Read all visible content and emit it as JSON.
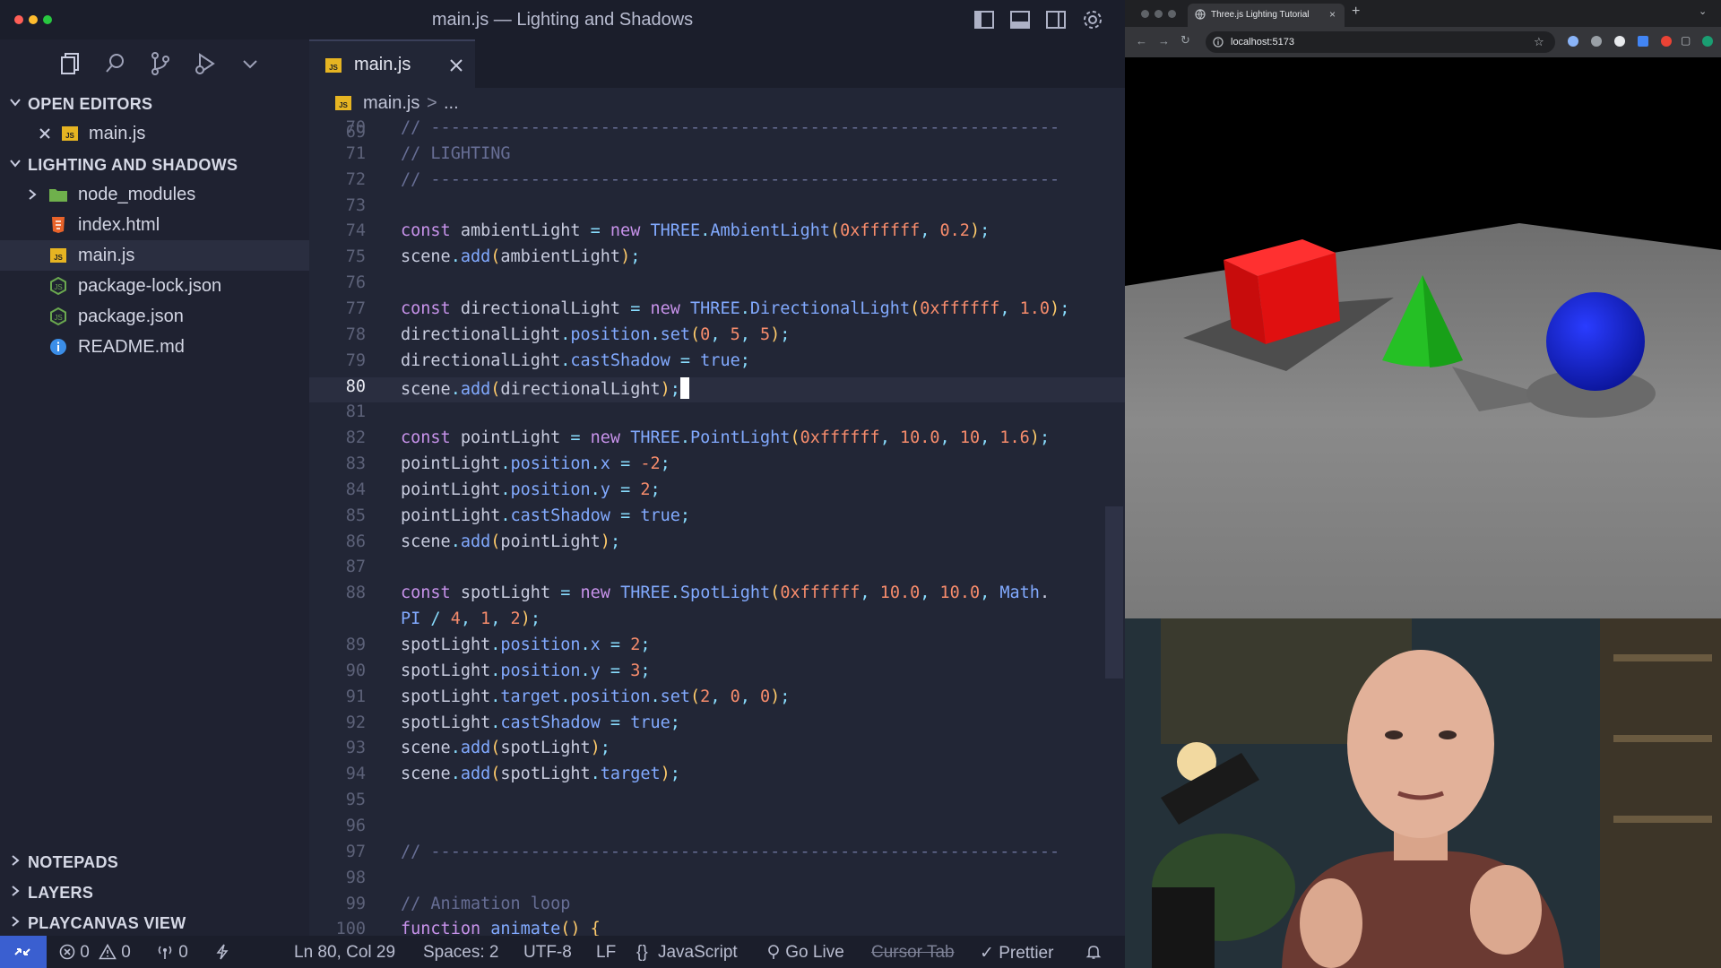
{
  "window": {
    "title": "main.js — Lighting and Shadows"
  },
  "tabs": [
    {
      "label": "main.js",
      "icon": "js-file-icon",
      "active": true
    }
  ],
  "breadcrumb": {
    "file": "main.js",
    "separator": ">",
    "rest": "..."
  },
  "sidebar": {
    "open_editors": {
      "title": "OPEN EDITORS",
      "items": [
        {
          "label": "main.js",
          "icon": "js-file-icon"
        }
      ]
    },
    "project": {
      "title": "LIGHTING AND SHADOWS",
      "items": [
        {
          "label": "node_modules",
          "icon": "folder-icon"
        },
        {
          "label": "index.html",
          "icon": "html-file-icon"
        },
        {
          "label": "main.js",
          "icon": "js-file-icon"
        },
        {
          "label": "package-lock.json",
          "icon": "node-file-icon"
        },
        {
          "label": "package.json",
          "icon": "node-file-icon"
        },
        {
          "label": "README.md",
          "icon": "info-file-icon"
        }
      ]
    },
    "bottom_sections": [
      {
        "label": "NOTEPADS"
      },
      {
        "label": "LAYERS"
      },
      {
        "label": "PLAYCANVAS VIEW"
      }
    ]
  },
  "code": {
    "partial_top_line": "69",
    "current_line": 80,
    "lines": [
      {
        "n": "70",
        "text": "// ---------------------------------------------------------------"
      },
      {
        "n": "71",
        "text": "// LIGHTING"
      },
      {
        "n": "72",
        "text": "// ---------------------------------------------------------------"
      },
      {
        "n": "73",
        "text": ""
      },
      {
        "n": "74",
        "text": "const ambientLight = new THREE.AmbientLight(0xffffff, 0.2);"
      },
      {
        "n": "75",
        "text": "scene.add(ambientLight);"
      },
      {
        "n": "76",
        "text": ""
      },
      {
        "n": "77",
        "text": "const directionalLight = new THREE.DirectionalLight(0xffffff, 1.0);"
      },
      {
        "n": "78",
        "text": "directionalLight.position.set(0, 5, 5);"
      },
      {
        "n": "79",
        "text": "directionalLight.castShadow = true;"
      },
      {
        "n": "80",
        "text": "scene.add(directionalLight);"
      },
      {
        "n": "81",
        "text": ""
      },
      {
        "n": "82",
        "text": "const pointLight = new THREE.PointLight(0xffffff, 10.0, 10, 1.6);"
      },
      {
        "n": "83",
        "text": "pointLight.position.x = -2;"
      },
      {
        "n": "84",
        "text": "pointLight.position.y = 2;"
      },
      {
        "n": "85",
        "text": "pointLight.castShadow = true;"
      },
      {
        "n": "86",
        "text": "scene.add(pointLight);"
      },
      {
        "n": "87",
        "text": ""
      },
      {
        "n": "88",
        "text": "const spotLight = new THREE.SpotLight(0xffffff, 10.0, 10.0, Math."
      },
      {
        "n": "",
        "text": "PI / 4, 1, 2);"
      },
      {
        "n": "89",
        "text": "spotLight.position.x = 2;"
      },
      {
        "n": "90",
        "text": "spotLight.position.y = 3;"
      },
      {
        "n": "91",
        "text": "spotLight.target.position.set(2, 0, 0);"
      },
      {
        "n": "92",
        "text": "spotLight.castShadow = true;"
      },
      {
        "n": "93",
        "text": "scene.add(spotLight);"
      },
      {
        "n": "94",
        "text": "scene.add(spotLight.target);"
      },
      {
        "n": "95",
        "text": ""
      },
      {
        "n": "96",
        "text": ""
      },
      {
        "n": "97",
        "text": "// ---------------------------------------------------------------"
      },
      {
        "n": "98",
        "text": ""
      },
      {
        "n": "99",
        "text": "// Animation loop"
      },
      {
        "n": "100",
        "text": "function animate() {"
      }
    ]
  },
  "statusbar": {
    "errors": "0",
    "warnings": "0",
    "ports": "0",
    "position": "Ln 80, Col 29",
    "spaces": "Spaces: 2",
    "encoding": "UTF-8",
    "eol": "LF",
    "language": "JavaScript",
    "go_live": "Go Live",
    "cursor_tab": "Cursor Tab",
    "prettier": "Prettier"
  },
  "browser": {
    "tab_title": "Three.js Lighting Tutorial",
    "url": "localhost:5173"
  },
  "colors": {
    "accent": "#3a5fd0",
    "cube": "#e01010",
    "cone": "#2ecc2e",
    "sphere": "#1020d0"
  }
}
